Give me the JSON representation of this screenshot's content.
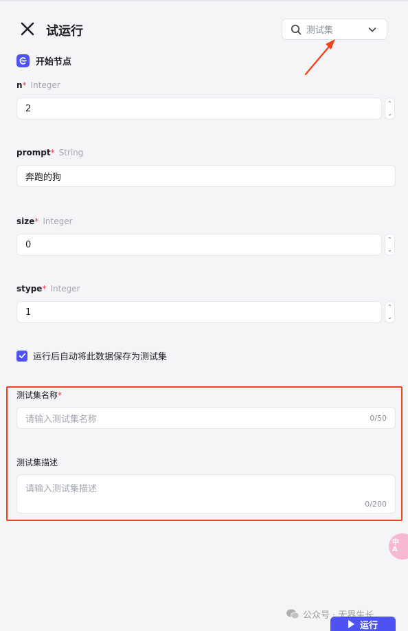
{
  "header": {
    "title": "试运行",
    "testset_select": {
      "placeholder": "测试集"
    }
  },
  "start_node": {
    "title": "开始节点"
  },
  "fields": [
    {
      "name": "n",
      "type": "Integer",
      "required": "*",
      "value": "2"
    },
    {
      "name": "prompt",
      "type": "String",
      "required": "*",
      "value": "奔跑的狗"
    },
    {
      "name": "size",
      "type": "Integer",
      "required": "*",
      "value": "0"
    },
    {
      "name": "stype",
      "type": "Integer",
      "required": "*",
      "value": "1"
    }
  ],
  "save_testset": {
    "checked": true,
    "label": "运行后自动将此数据保存为测试集",
    "name_label": "测试集名称",
    "name_required": "*",
    "name_placeholder": "请输入测试集名称",
    "name_counter": "0/50",
    "desc_label": "测试集描述",
    "desc_placeholder": "请输入测试集描述",
    "desc_counter": "0/200"
  },
  "floating": {
    "translate_label_top": "中",
    "translate_label_bottom": "A"
  },
  "watermark": {
    "text": "公众号 · 无界生长"
  },
  "footer": {
    "run_label": "运行"
  },
  "colors": {
    "accent": "#4e52f2",
    "annotation": "#f2441c",
    "required": "#f2394f"
  },
  "icons": [
    "close-icon",
    "search-icon",
    "chevron-down-icon",
    "start-node-icon",
    "check-icon",
    "play-icon",
    "wechat-icon",
    "translate-icon"
  ]
}
